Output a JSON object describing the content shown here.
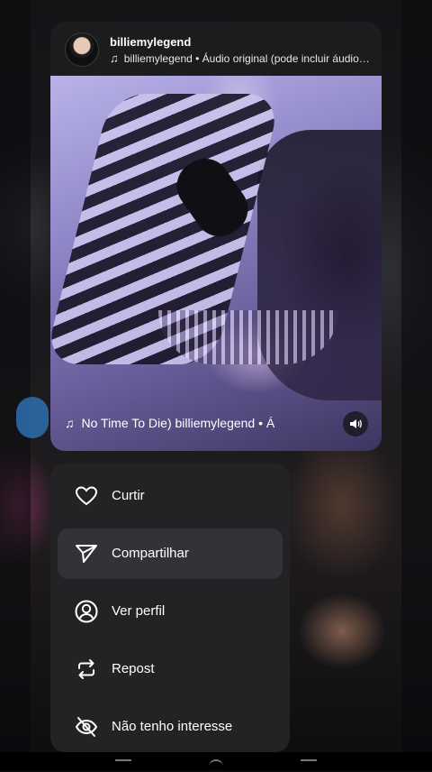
{
  "post": {
    "username": "billiemylegend",
    "audio_subtitle": "billiemylegend • Áudio original (pode incluir áudio…",
    "video_audio_label": "No Time To Die)   billiemylegend • Á"
  },
  "menu": {
    "items": [
      {
        "label": "Curtir",
        "icon": "heart-icon"
      },
      {
        "label": "Compartilhar",
        "icon": "send-icon"
      },
      {
        "label": "Ver perfil",
        "icon": "profile-icon"
      },
      {
        "label": "Repost",
        "icon": "repost-icon"
      },
      {
        "label": "Não tenho interesse",
        "icon": "eye-off-icon"
      }
    ],
    "active_index": 1
  },
  "colors": {
    "accent_blue": "#2f6fb0",
    "menu_bg": "#232326",
    "active_bg": "#333337"
  }
}
